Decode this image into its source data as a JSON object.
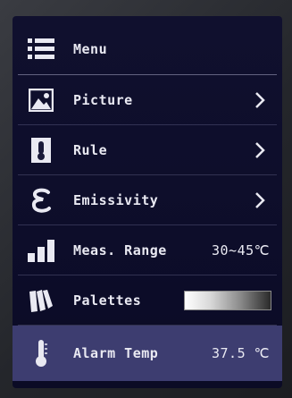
{
  "menu": {
    "title": "Menu",
    "items": [
      {
        "label": "Picture",
        "icon": "picture-icon"
      },
      {
        "label": "Rule",
        "icon": "thermometer-rule-icon"
      },
      {
        "label": "Emissivity",
        "icon": "epsilon-icon"
      },
      {
        "label": "Meas. Range",
        "icon": "bar-chart-icon",
        "value": "30~45℃"
      },
      {
        "label": "Palettes",
        "icon": "palettes-icon"
      },
      {
        "label": "Alarm Temp",
        "icon": "thermometer-icon",
        "value": "37.5 ℃"
      }
    ]
  },
  "colors": {
    "screen_bg": "#10102e",
    "selected_row": "#3d3d70",
    "text": "#e9e9f2"
  }
}
